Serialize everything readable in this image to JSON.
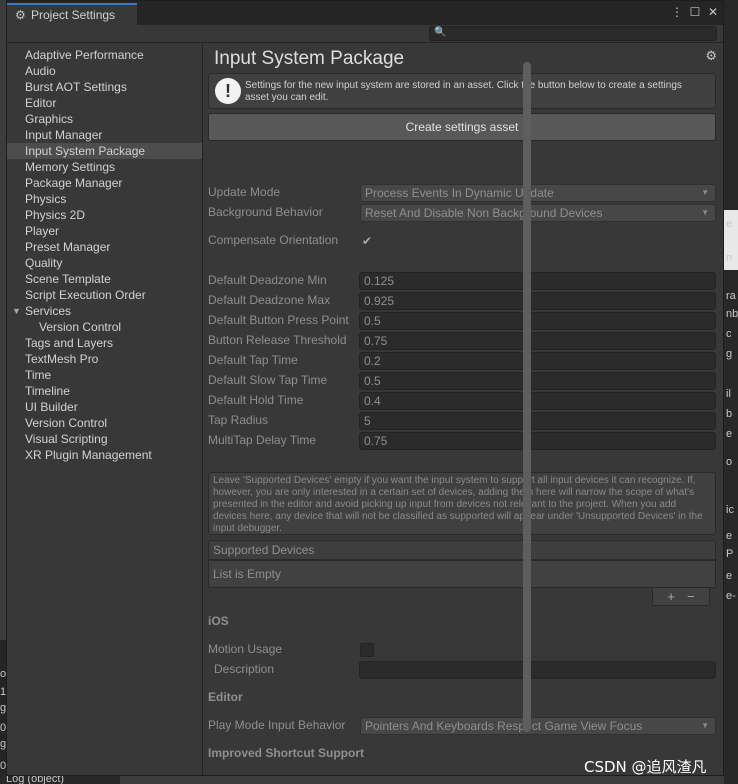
{
  "window": {
    "tab_title": "Project Settings",
    "controls": [
      "⋮",
      "☐",
      "✕"
    ]
  },
  "search": {
    "value": ""
  },
  "sidebar": {
    "items": [
      "Adaptive Performance",
      "Audio",
      "Burst AOT Settings",
      "Editor",
      "Graphics",
      "Input Manager",
      "Input System Package",
      "Memory Settings",
      "Package Manager",
      "Physics",
      "Physics 2D",
      "Player",
      "Preset Manager",
      "Quality",
      "Scene Template",
      "Script Execution Order",
      "Services",
      "Version Control",
      "Tags and Layers",
      "TextMesh Pro",
      "Time",
      "Timeline",
      "UI Builder",
      "Version Control",
      "Visual Scripting",
      "XR Plugin Management"
    ],
    "selected": "Input System Package"
  },
  "main": {
    "title": "Input System Package",
    "info": "Settings for the new input system are stored in an asset. Click the button below to create a settings asset you can edit.",
    "create_button": "Create settings asset",
    "update_mode": {
      "label": "Update Mode",
      "value": "Process Events In Dynamic Update"
    },
    "background_behavior": {
      "label": "Background Behavior",
      "value": "Reset And Disable Non Background Devices"
    },
    "compensate_orientation": {
      "label": "Compensate Orientation",
      "checked": true
    },
    "fields": [
      {
        "label": "Default Deadzone Min",
        "value": "0.125"
      },
      {
        "label": "Default Deadzone Max",
        "value": "0.925"
      },
      {
        "label": "Default Button Press Point",
        "value": "0.5"
      },
      {
        "label": "Button Release Threshold",
        "value": "0.75"
      },
      {
        "label": "Default Tap Time",
        "value": "0.2"
      },
      {
        "label": "Default Slow Tap Time",
        "value": "0.5"
      },
      {
        "label": "Default Hold Time",
        "value": "0.4"
      },
      {
        "label": "Tap Radius",
        "value": "5"
      },
      {
        "label": "MultiTap Delay Time",
        "value": "0.75"
      }
    ],
    "devices_help": "Leave 'Supported Devices' empty if you want the input system to support all input devices it can recognize. If, however, you are only interested in a certain set of devices, adding them here will narrow the scope of what's presented in the editor and avoid picking up input from devices not relevant to the project. When you add devices here, any device that will not be classified as supported will appear under 'Unsupported Devices' in the input debugger.",
    "supported_devices": {
      "header": "Supported Devices",
      "empty_text": "List is Empty",
      "add": "+",
      "remove": "−"
    },
    "ios": {
      "title": "iOS",
      "motion_usage_label": "Motion Usage",
      "description_label": "Description",
      "description_value": ""
    },
    "editor": {
      "title": "Editor",
      "play_mode_label": "Play Mode Input Behavior",
      "play_mode_value": "Pointers And Keyboards Respect Game View Focus"
    },
    "shortcut": {
      "title": "Improved Shortcut Support"
    }
  },
  "watermark": "CSDN @追风渣凡",
  "background_fragments": {
    "right": [
      "e",
      "n",
      "ra",
      "nb",
      "c",
      "g",
      "il",
      "b",
      "e",
      "o",
      "ic",
      "e",
      "P",
      "e",
      "e-"
    ],
    "left": [
      "or",
      "1",
      "g",
      "0",
      "g",
      "0"
    ],
    "bottom": "Log (object)"
  }
}
